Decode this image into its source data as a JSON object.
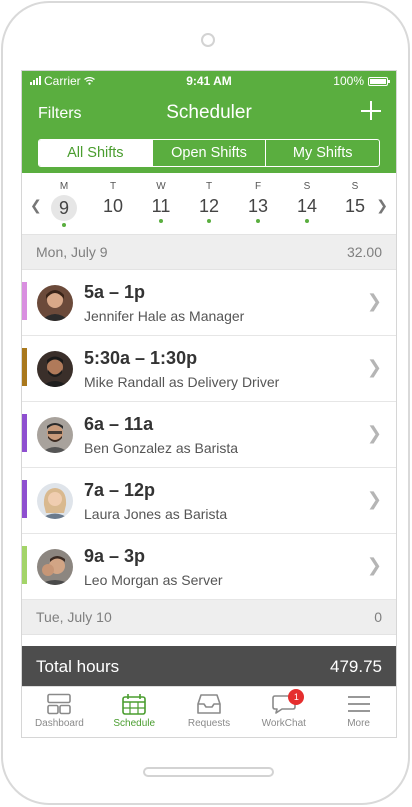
{
  "status_bar": {
    "carrier": "Carrier",
    "time": "9:41 AM",
    "battery": "100%"
  },
  "header": {
    "filters_label": "Filters",
    "title": "Scheduler",
    "add_icon": "plus-icon"
  },
  "segments": [
    {
      "label": "All Shifts",
      "active": true
    },
    {
      "label": "Open Shifts",
      "active": false
    },
    {
      "label": "My Shifts",
      "active": false
    }
  ],
  "week": {
    "days": [
      {
        "dow": "M",
        "date": "9",
        "selected": true,
        "has_shift": true
      },
      {
        "dow": "T",
        "date": "10",
        "selected": false,
        "has_shift": false
      },
      {
        "dow": "W",
        "date": "11",
        "selected": false,
        "has_shift": true
      },
      {
        "dow": "T",
        "date": "12",
        "selected": false,
        "has_shift": true
      },
      {
        "dow": "F",
        "date": "13",
        "selected": false,
        "has_shift": true
      },
      {
        "dow": "S",
        "date": "14",
        "selected": false,
        "has_shift": true
      },
      {
        "dow": "S",
        "date": "15",
        "selected": false,
        "has_shift": false
      }
    ]
  },
  "sections": [
    {
      "date": "Mon, July 9",
      "hours": "32.00"
    },
    {
      "date": "Tue, July 10",
      "hours": "0"
    }
  ],
  "shifts": [
    {
      "time": "5a – 1p",
      "who": "Jennifer Hale as Manager",
      "color": "#d98fe0",
      "avatar_bg": "#6b4a3a"
    },
    {
      "time": "5:30a – 1:30p",
      "who": "Mike Randall as Delivery Driver",
      "color": "#a9781c",
      "avatar_bg": "#3a2f2a"
    },
    {
      "time": "6a – 11a",
      "who": "Ben Gonzalez as Barista",
      "color": "#8e4fd0",
      "avatar_bg": "#8a7a70"
    },
    {
      "time": "7a – 12p",
      "who": "Laura Jones as Barista",
      "color": "#8e4fd0",
      "avatar_bg": "#c9a78a"
    },
    {
      "time": "9a – 3p",
      "who": "Leo Morgan as Server",
      "color": "#a3d468",
      "avatar_bg": "#7b6a5c"
    }
  ],
  "total": {
    "label": "Total hours",
    "value": "479.75"
  },
  "tabs": [
    {
      "label": "Dashboard",
      "icon": "dashboard-icon",
      "active": false
    },
    {
      "label": "Schedule",
      "icon": "calendar-icon",
      "active": true
    },
    {
      "label": "Requests",
      "icon": "inbox-icon",
      "active": false
    },
    {
      "label": "WorkChat",
      "icon": "chat-icon",
      "active": false,
      "badge": "1"
    },
    {
      "label": "More",
      "icon": "menu-icon",
      "active": false
    }
  ],
  "colors": {
    "brand_green": "#5aae3f",
    "total_bar": "#4d4d4d",
    "badge_red": "#e52e2e"
  }
}
